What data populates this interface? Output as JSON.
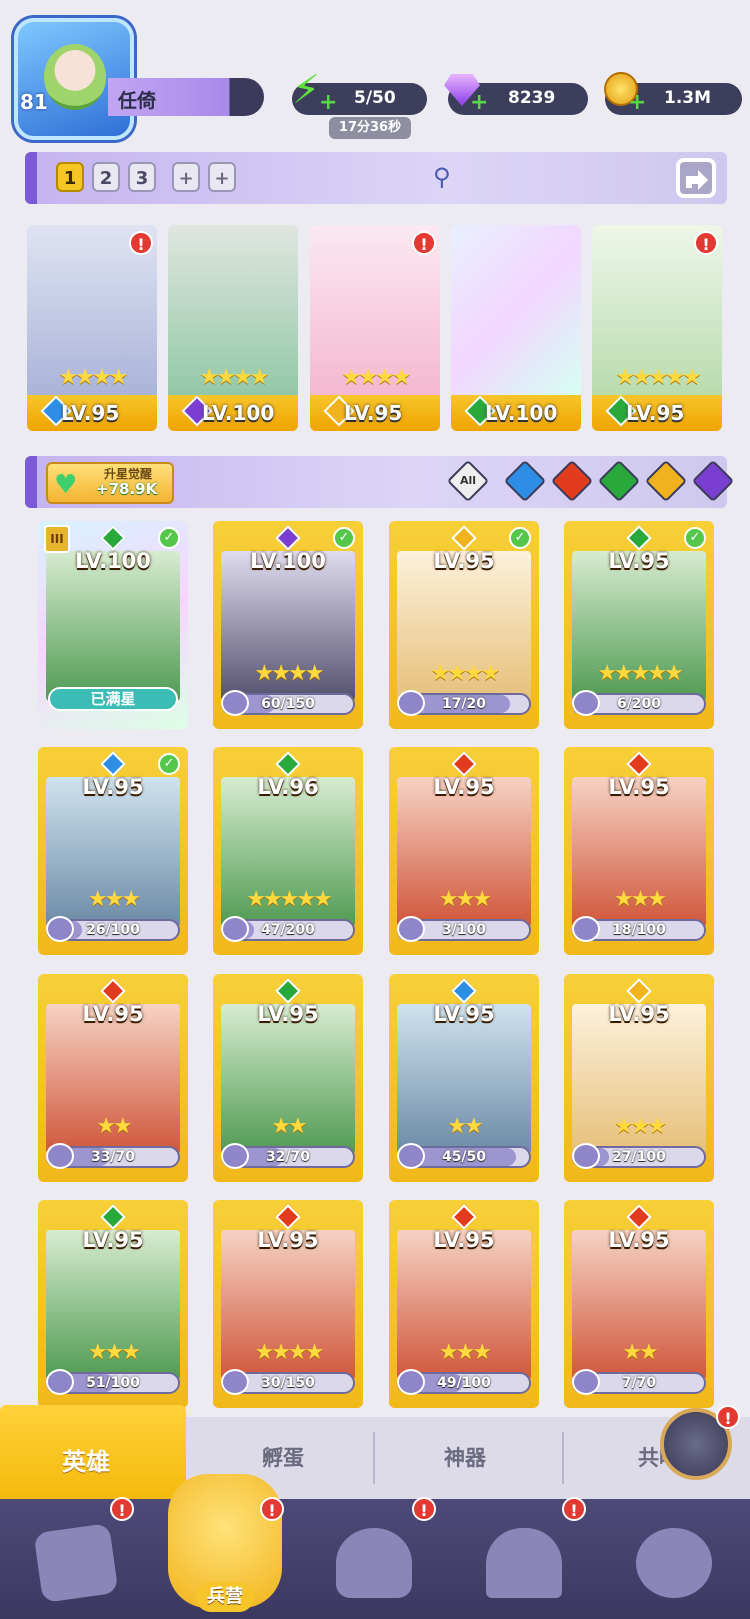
{
  "player": {
    "level": "81",
    "name": "任倚"
  },
  "resources": {
    "energy": "5/50",
    "energy_timer": "17分36秒",
    "gems": "8239",
    "coins": "1.3M"
  },
  "team_tabs": [
    "1",
    "2",
    "3",
    "+",
    "+"
  ],
  "team_heroes": [
    {
      "level": "LV.95",
      "stars": "★★★★",
      "element": "water",
      "alert": "!"
    },
    {
      "level": "LV.100",
      "stars": "★★★★",
      "element": "dark",
      "alert": ""
    },
    {
      "level": "LV.95",
      "stars": "★★★★",
      "element": "light",
      "alert": "!"
    },
    {
      "level": "LV.100",
      "stars": "",
      "element": "wood",
      "alert": ""
    },
    {
      "level": "LV.95",
      "stars": "★★★★★",
      "element": "wood",
      "alert": "!"
    }
  ],
  "upgrade": {
    "title": "升星觉醒",
    "value": "+78.9K"
  },
  "filters": {
    "all_label": "All",
    "elements": [
      "water",
      "fire",
      "wood",
      "light",
      "dark"
    ]
  },
  "element_colors": {
    "water": "#2e8ee6",
    "fire": "#e23b1d",
    "wood": "#29a83c",
    "light": "#f0b21d",
    "dark": "#7a3fd1"
  },
  "heroes": [
    {
      "level": "LV.100",
      "element": "wood",
      "stars": "",
      "shards": "已满星",
      "progress": 1.0,
      "owned": true,
      "maxed": true
    },
    {
      "level": "LV.100",
      "element": "dark",
      "stars": "★★★★",
      "shards": "60/150",
      "progress": 0.4,
      "owned": true,
      "maxed": false
    },
    {
      "level": "LV.95",
      "element": "light",
      "stars": "★★★★",
      "shards": "17/20",
      "progress": 0.85,
      "owned": true,
      "maxed": false
    },
    {
      "level": "LV.95",
      "element": "wood",
      "stars": "★★★★★",
      "shards": "6/200",
      "progress": 0.03,
      "owned": true,
      "maxed": false
    },
    {
      "level": "LV.95",
      "element": "water",
      "stars": "★★★",
      "shards": "26/100",
      "progress": 0.26,
      "owned": true,
      "maxed": false
    },
    {
      "level": "LV.96",
      "element": "wood",
      "stars": "★★★★★",
      "shards": "47/200",
      "progress": 0.235,
      "owned": false,
      "maxed": false
    },
    {
      "level": "LV.95",
      "element": "fire",
      "stars": "★★★",
      "shards": "3/100",
      "progress": 0.03,
      "owned": false,
      "maxed": false
    },
    {
      "level": "LV.95",
      "element": "fire",
      "stars": "★★★",
      "shards": "18/100",
      "progress": 0.18,
      "owned": false,
      "maxed": false
    },
    {
      "level": "LV.95",
      "element": "fire",
      "stars": "★★",
      "shards": "33/70",
      "progress": 0.47,
      "owned": false,
      "maxed": false
    },
    {
      "level": "LV.95",
      "element": "wood",
      "stars": "★★",
      "shards": "32/70",
      "progress": 0.46,
      "owned": false,
      "maxed": false
    },
    {
      "level": "LV.95",
      "element": "water",
      "stars": "★★",
      "shards": "45/50",
      "progress": 0.9,
      "owned": false,
      "maxed": false
    },
    {
      "level": "LV.95",
      "element": "light",
      "stars": "★★★",
      "shards": "27/100",
      "progress": 0.27,
      "owned": false,
      "maxed": false
    },
    {
      "level": "LV.95",
      "element": "wood",
      "stars": "★★★",
      "shards": "51/100",
      "progress": 0.51,
      "owned": false,
      "maxed": false
    },
    {
      "level": "LV.95",
      "element": "fire",
      "stars": "★★★★",
      "shards": "30/150",
      "progress": 0.2,
      "owned": false,
      "maxed": false
    },
    {
      "level": "LV.95",
      "element": "fire",
      "stars": "★★★",
      "shards": "49/100",
      "progress": 0.49,
      "owned": false,
      "maxed": false
    },
    {
      "level": "LV.95",
      "element": "fire",
      "stars": "★★",
      "shards": "7/70",
      "progress": 0.1,
      "owned": false,
      "maxed": false
    }
  ],
  "sub_tabs": [
    "英雄",
    "孵蛋",
    "神器",
    "共鸣"
  ],
  "bottom_nav": {
    "camp_label": "兵营",
    "alert": "!"
  }
}
